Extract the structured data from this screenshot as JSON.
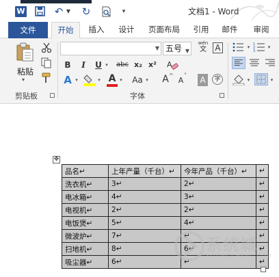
{
  "window": {
    "title": "文档1 - Word"
  },
  "app_logo": "W",
  "qat": {
    "icons": [
      "save-icon",
      "undo-icon",
      "redo-icon",
      "print-preview-icon",
      "customize-qat-icon"
    ]
  },
  "tabs": [
    {
      "label": "文件"
    },
    {
      "label": "开始"
    },
    {
      "label": "插入"
    },
    {
      "label": "设计"
    },
    {
      "label": "页面布局"
    },
    {
      "label": "引用"
    },
    {
      "label": "邮件"
    },
    {
      "label": "审阅"
    }
  ],
  "ribbon": {
    "clipboard": {
      "paste_label": "粘贴",
      "group_label": "剪贴板"
    },
    "font": {
      "font_name": "",
      "font_size": "五号",
      "phonetic_top": "wén",
      "phonetic_bottom": "文",
      "border_char": "A",
      "bold": "B",
      "italic": "I",
      "underline": "U",
      "strike": "abc",
      "subscript": "x₂",
      "superscript": "x²",
      "change_case": "Aa",
      "grow": "A",
      "shrink": "A",
      "shade_char": "A",
      "circle_char": "字",
      "group_label": "字体"
    }
  },
  "table": {
    "headers": [
      "品名",
      "上年产量（千台）",
      "今年产品（千台）"
    ],
    "rows": [
      [
        "洗衣机",
        "3",
        "2"
      ],
      [
        "电冰箱",
        "4",
        "3"
      ],
      [
        "电视机",
        "2",
        "2"
      ],
      [
        "电饭煲",
        "5",
        "4"
      ],
      [
        "微波炉",
        "7",
        ""
      ],
      [
        "扫地机",
        "8",
        "6"
      ],
      [
        "吸尘器",
        "6",
        ""
      ]
    ]
  },
  "watermark": {
    "cn": "系统城",
    "en": "XITONGCHENG.COM"
  }
}
